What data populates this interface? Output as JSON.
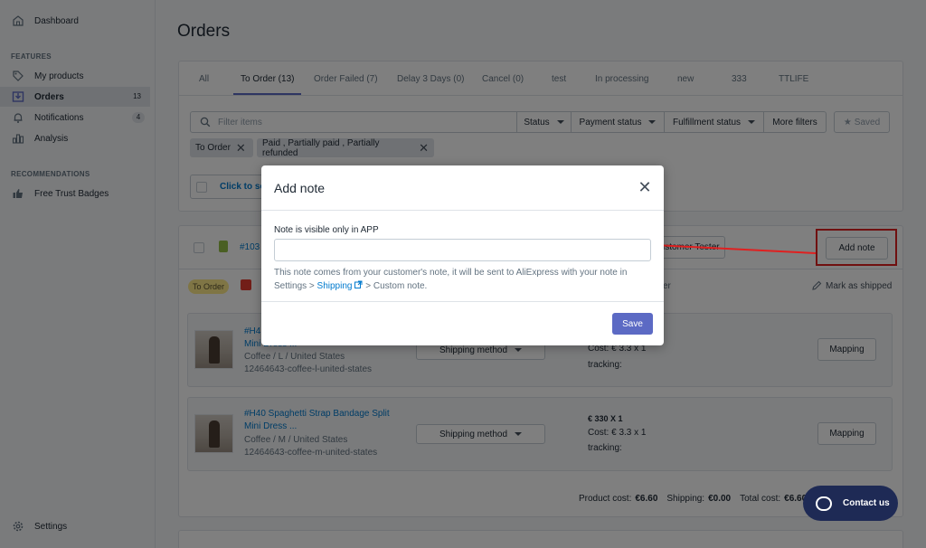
{
  "sidebar": {
    "dashboard": "Dashboard",
    "features_label": "FEATURES",
    "items": [
      {
        "label": "My products",
        "icon": "tag-icon"
      },
      {
        "label": "Orders",
        "icon": "inbox-download-icon",
        "count": "13"
      },
      {
        "label": "Notifications",
        "icon": "bell-icon",
        "count": "4"
      },
      {
        "label": "Analysis",
        "icon": "bar-chart-icon"
      }
    ],
    "recommendations_label": "RECOMMENDATIONS",
    "recommendation": "Free Trust Badges",
    "settings": "Settings"
  },
  "page": {
    "title": "Orders"
  },
  "tabs": [
    "All",
    "To Order (13)",
    "Order Failed (7)",
    "Delay 3 Days (0)",
    "Cancel (0)",
    "test",
    "In processing",
    "new",
    "333",
    "TTLIFE"
  ],
  "filters": {
    "search_placeholder": "Filter items",
    "status": "Status",
    "payment_status": "Payment status",
    "fulfillment_status": "Fulfillment status",
    "more_filters": "More filters",
    "saved": "Saved"
  },
  "chips": [
    "To Order",
    "Paid , Partially paid , Partially refunded"
  ],
  "select_text": "Click to se",
  "order": {
    "number": "#103",
    "customer_btn": "Customer Tester",
    "add_note": "Add note",
    "status_badge": "To Order",
    "partial_text": "er",
    "mark_shipped": "Mark as shipped",
    "items": [
      {
        "title1": "#H4",
        "title2": "Mini Dress ...",
        "variant": "Coffee / L / United States",
        "sku": "12464643-coffee-l-united-states",
        "shipping": "Shipping method",
        "cost": "Cost: € 3.3 x 1",
        "tracking": "tracking:",
        "mapping": "Mapping"
      },
      {
        "title1": "#H40 Spaghetti Strap Bandage Split",
        "title2": "Mini Dress ...",
        "variant": "Coffee / M / United States",
        "sku": "12464643-coffee-m-united-states",
        "shipping": "Shipping method",
        "price": "€ 330 X 1",
        "cost": "Cost: € 3.3 x 1",
        "tracking": "tracking:",
        "mapping": "Mapping"
      }
    ],
    "product_cost_label": "Product cost:",
    "product_cost": "€6.60",
    "shipping_label": "Shipping:",
    "shipping": "€0.00",
    "total_label": "Total cost:",
    "total": "€6.60"
  },
  "modal": {
    "title": "Add note",
    "label": "Note is visible only in APP",
    "input_value": "",
    "help_prefix": "This note comes from your customer's note, it will be sent to AliExpress with your note in Settings > ",
    "help_link": "Shipping",
    "help_suffix": " > Custom note.",
    "save": "Save"
  },
  "contact": "Contact us",
  "colors": {
    "primary": "#5c6ac4",
    "annotation": "#e02020",
    "contact_bg": "#1e2a55"
  }
}
